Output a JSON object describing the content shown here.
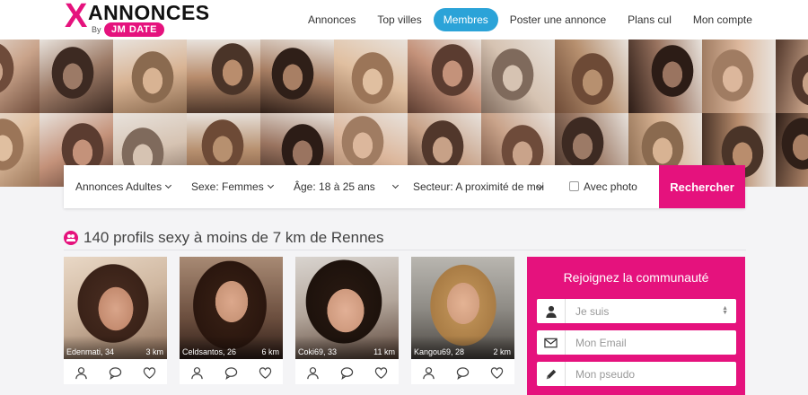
{
  "header": {
    "logo": {
      "x": "X",
      "word": "ANNONCES",
      "by": "By",
      "brand": "JM DATE"
    },
    "nav": [
      {
        "label": "Annonces",
        "active": false
      },
      {
        "label": "Top villes",
        "active": false
      },
      {
        "label": "Membres",
        "active": true
      },
      {
        "label": "Poster une annonce",
        "active": false
      },
      {
        "label": "Plans cul",
        "active": false
      },
      {
        "label": "Mon compte",
        "active": false
      }
    ]
  },
  "search": {
    "category": "Annonces Adultes",
    "sex": "Sexe: Femmes",
    "age": "Âge: 18 à 25 ans",
    "sector": "Secteur: A proximité de moi",
    "photo_label": "Avec photo",
    "button": "Rechercher"
  },
  "section": {
    "title": "140 profils sexy à moins de 7 km de Rennes"
  },
  "profiles": [
    {
      "name": "Edenmati, 34",
      "distance": "3 km"
    },
    {
      "name": "Celdsantos, 26",
      "distance": "6 km"
    },
    {
      "name": "Coki69, 33",
      "distance": "11 km"
    },
    {
      "name": "Kangou69, 28",
      "distance": "2 km"
    }
  ],
  "join": {
    "title": "Rejoignez la communauté",
    "gender_placeholder": "Je suis",
    "email_placeholder": "Mon Email",
    "pseudo_placeholder": "Mon pseudo"
  },
  "colors": {
    "brand": "#e5127d",
    "nav_active": "#2ba3d8"
  }
}
